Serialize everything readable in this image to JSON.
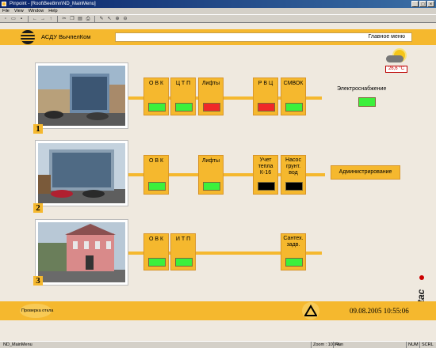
{
  "window": {
    "title": "Pinpoint - [Root\\Bee8mn\\ND_MainMenu]",
    "buttons": [
      "_",
      "□",
      "×"
    ]
  },
  "menu": [
    "File",
    "View",
    "Window",
    "Help"
  ],
  "toolbar_icons": [
    "new-icon",
    "open-icon",
    "save-icon",
    "back-icon",
    "forward-icon",
    "up-icon",
    "cut-icon",
    "copy-icon",
    "paste-icon",
    "print-icon",
    "edit-icon",
    "select-icon",
    "zoom-in-icon",
    "zoom-out-icon"
  ],
  "header": {
    "app_name": "АСДУ ВычпелКом",
    "menu_label": "Главное меню"
  },
  "weather": {
    "temperature": "26,6 °C"
  },
  "rows": [
    {
      "number": "1",
      "units": [
        {
          "label": "О В К",
          "status": "green"
        },
        {
          "label": "Ц Т П",
          "status": "green"
        },
        {
          "label": "Лифты",
          "status": "red"
        },
        {
          "label": "Р В Ц",
          "status": "red"
        },
        {
          "label": "СМВОК",
          "status": "green"
        }
      ]
    },
    {
      "number": "2",
      "units": [
        {
          "label": "О В К",
          "status": "green"
        },
        {
          "label": "Лифты",
          "status": "green"
        },
        {
          "label": "Учет тепла К-16",
          "status": "black"
        },
        {
          "label": "Насос грунт. вод",
          "status": "black"
        }
      ]
    },
    {
      "number": "3",
      "units": [
        {
          "label": "О В К",
          "status": "green"
        },
        {
          "label": "И Т П",
          "status": "green"
        },
        {
          "label": "Сантех. задв.",
          "status": "green"
        }
      ]
    }
  ],
  "electric": {
    "label": "Электроснабжение",
    "status": "green"
  },
  "admin_button": "Администрирование",
  "brand": "tac",
  "footer": {
    "check_label": "Проверка откла",
    "datetime": "09.08.2005 10:55:06"
  },
  "statusbar": {
    "left": "ND_MainMenu",
    "zoom": "Zoom : 100 %",
    "mode": "Run",
    "caps": "NUM",
    "scroll": "SCRL"
  },
  "colors": {
    "accent": "#f5b82e",
    "background": "#efe9df",
    "ok": "#3cf03c",
    "alarm": "#f02828",
    "off": "#000000"
  }
}
